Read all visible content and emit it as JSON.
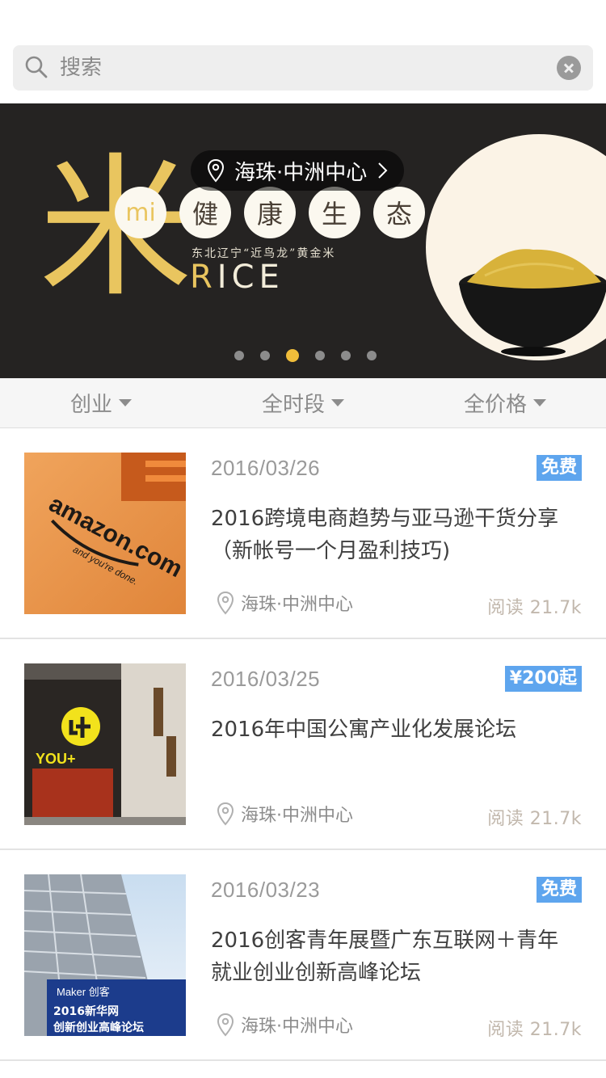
{
  "search": {
    "placeholder": "搜索"
  },
  "banner": {
    "location_label": "海珠·中洲中心",
    "big_char": "米",
    "mi_circle": "mi",
    "circles": [
      "健",
      "康",
      "生",
      "态"
    ],
    "subtitle": "东北辽宁“近鸟龙”黄金米",
    "rice_r": "R",
    "rice_rest": "ICE",
    "dots_total": 6,
    "active_dot": 3
  },
  "filters": [
    {
      "label": "创业"
    },
    {
      "label": "全时段"
    },
    {
      "label": "全价格"
    }
  ],
  "events": [
    {
      "date": "2016/03/26",
      "price": "免费",
      "title": "2016跨境电商趋势与亚马逊干货分享（新帐号一个月盈利技巧)",
      "location": "海珠·中洲中心",
      "views": "阅读 21.7k",
      "thumb_label": "amazon.com",
      "thumb_sub": "and you're done."
    },
    {
      "date": "2016/03/25",
      "price": "¥200起",
      "title": "2016年中国公寓产业化发展论坛",
      "location": "海珠·中洲中心",
      "views": "阅读 21.7k",
      "thumb_label": "YOU+"
    },
    {
      "date": "2016/03/23",
      "price": "免费",
      "title": "2016创客青年展暨广东互联网＋青年就业创业创新高峰论坛",
      "location": "海珠·中洲中心",
      "views": "阅读 21.7k",
      "thumb_label": "2016新华网",
      "thumb_sub": "创新创业高峰论坛"
    }
  ],
  "colors": {
    "accent_gold": "#e9c55f",
    "tag_blue": "#5ea5ee",
    "banner_bg": "#252322"
  }
}
